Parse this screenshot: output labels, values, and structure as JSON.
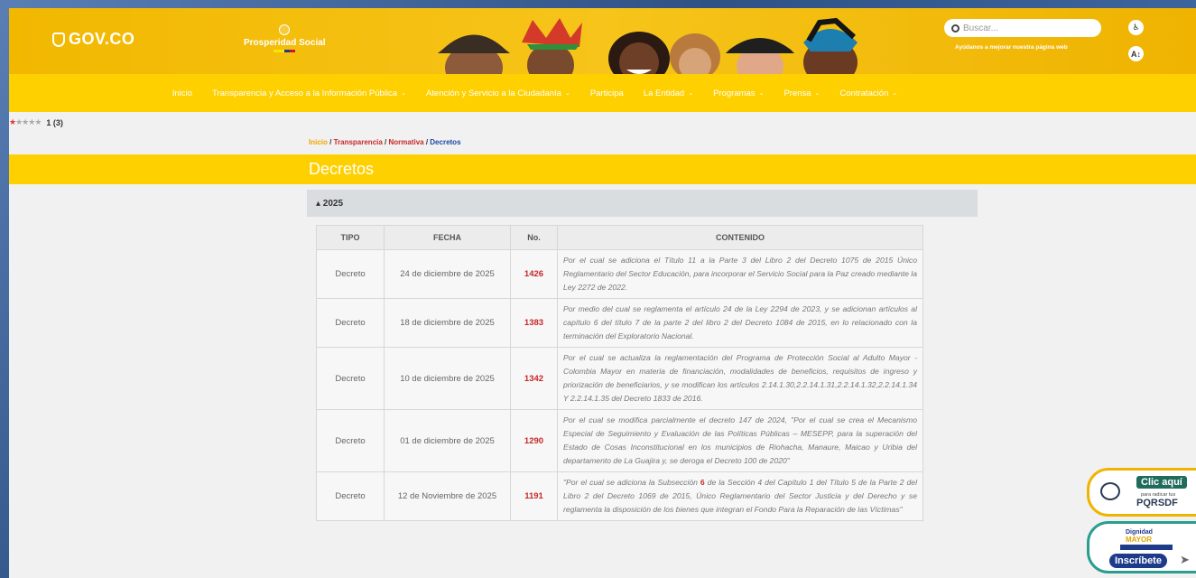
{
  "header": {
    "gov_logo": "GOV.CO",
    "agency_logo": "Prosperidad Social",
    "search_placeholder": "Buscar...",
    "help_text": "Ayúdanos a mejorar nuestra página web",
    "accessibility_icon": "accessibility-icon",
    "font_size_icon": "text-size-icon"
  },
  "nav": {
    "items": [
      {
        "label": "Inicio",
        "dropdown": false
      },
      {
        "label": "Transparencia y Acceso a la Información Pública",
        "dropdown": true
      },
      {
        "label": "Atención y Servicio a la Ciudadanía",
        "dropdown": true
      },
      {
        "label": "Participa",
        "dropdown": false
      },
      {
        "label": "La Entidad",
        "dropdown": true
      },
      {
        "label": "Programas",
        "dropdown": true
      },
      {
        "label": "Prensa",
        "dropdown": true
      },
      {
        "label": "Contratación",
        "dropdown": true
      }
    ]
  },
  "rating": {
    "stars_filled": 1,
    "stars_total": 5,
    "text": "1 (3)"
  },
  "breadcrumb": {
    "home": "Inicio",
    "sep": " / ",
    "level1": "Transparencia",
    "level2": "Normativa",
    "current": "Decretos"
  },
  "page_title": "Decretos",
  "year_section": {
    "label": "▴ 2025"
  },
  "table": {
    "headers": {
      "tipo": "TIPO",
      "fecha": "FECHA",
      "numero": "No.",
      "contenido": "CONTENIDO"
    },
    "rows": [
      {
        "tipo": "Decreto",
        "fecha": "24 de diciembre de 2025",
        "numero": "1426",
        "contenido": "Por el cual se adiciona el Título 11 a la Parte 3 del Libro 2 del Decreto 1075 de 2015 Único Reglamentario del Sector Educación, para incorporar el Servicio Social para la Paz creado mediante la Ley 2272 de 2022."
      },
      {
        "tipo": "Decreto",
        "fecha": "18 de diciembre de 2025",
        "numero": "1383",
        "contenido": "Por medio del cual se reglamenta el artículo 24 de la Ley 2294 de 2023, y se adicionan artículos al capítulo 6 del título 7 de la parte 2 del libro 2 del Decreto 1084 de 2015, en lo relacionado con la terminación del Exploratorio Nacional."
      },
      {
        "tipo": "Decreto",
        "fecha": "10 de diciembre de 2025",
        "numero": "1342",
        "contenido": "Por el cual se actualiza la reglamentación del Programa de Protección Social al Adulto Mayor -Colombia Mayor en materia de financiación, modalidades de beneficios, requisitos de ingreso y priorización de beneficiarios, y se modifican los artículos 2.14.1.30,2.2.14.1.31,2.2.14.1.32,2.2.14.1.34 Y 2.2.14.1.35 del Decreto 1833 de 2016."
      },
      {
        "tipo": "Decreto",
        "fecha": "01 de diciembre de 2025",
        "numero": "1290",
        "contenido": "Por el cual se modifica parcialmente el decreto 147 de 2024, \"Por el cual se crea el Mecanismo Especial de Seguimiento y Evaluación de las Políticas Públicas – MESEPP, para la superación del Estado de Cosas Inconstitucional en los municipios de Riohacha, Manaure, Maicao y Uribia del departamento de La Guajira y, se deroga el Decreto 100 de 2020\""
      },
      {
        "tipo": "Decreto",
        "fecha": "12 de Noviembre de 2025",
        "numero": "1191",
        "contenido_pre": "\"Por el cual se adiciona la Subsección ",
        "contenido_red": "6",
        "contenido_post": " de la Sección 4 del Capítulo 1 del Título 5 de la Parte 2 del Libro 2 del Decreto 1069 de 2015, Único Reglamentario del Sector Justicia y del Derecho y se reglamenta la disposición de los bienes que integran el Fondo Para la Reparación de las Víctimas\""
      }
    ]
  },
  "widgets": {
    "pqrs": {
      "button": "Clic aquí",
      "small": "para radicar tus",
      "code": "PQRSDF"
    },
    "dignidad": {
      "line1": "Dignidad",
      "line2": "MAYOR",
      "button": "Inscríbete"
    }
  }
}
